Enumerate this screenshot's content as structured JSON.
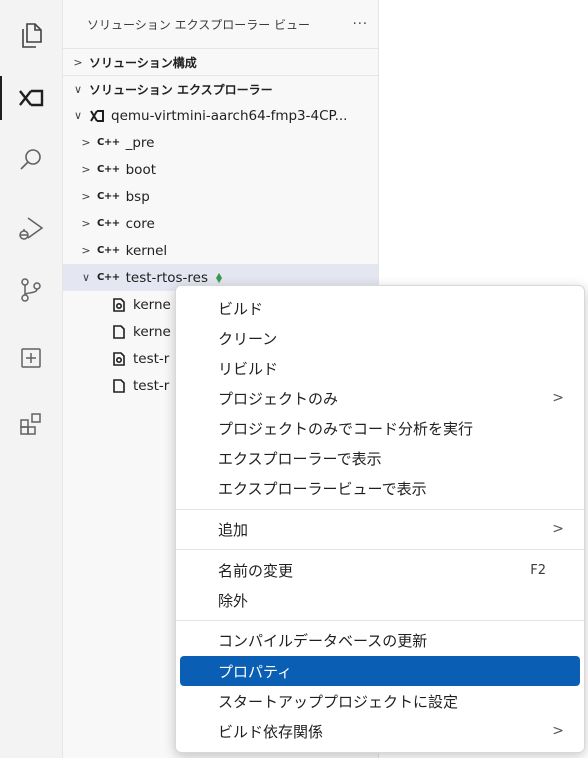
{
  "sidebar": {
    "title": "ソリューション エクスプローラー ビュー",
    "more": "···",
    "sections": {
      "config": "ソリューション構成",
      "explorer": "ソリューション エクスプローラー"
    },
    "project": "qemu-virtmini-aarch64-fmp3-4CP...",
    "folders": [
      "_pre",
      "boot",
      "bsp",
      "core",
      "kernel"
    ],
    "expanded_folder": "test-rtos-res",
    "files": [
      "kerne",
      "kerne",
      "test-r",
      "test-r"
    ]
  },
  "menu": {
    "items": [
      {
        "label": "ビルド"
      },
      {
        "label": "クリーン"
      },
      {
        "label": "リビルド"
      },
      {
        "label": "プロジェクトのみ",
        "submenu": true
      },
      {
        "label": "プロジェクトのみでコード分析を実行"
      },
      {
        "label": "エクスプローラーで表示"
      },
      {
        "label": "エクスプローラービューで表示"
      },
      {
        "label": "追加",
        "submenu": true
      },
      {
        "label": "名前の変更",
        "shortcut": "F2"
      },
      {
        "label": "除外"
      },
      {
        "label": "コンパイルデータベースの更新"
      },
      {
        "label": "プロパティ",
        "highlighted": true
      },
      {
        "label": "スタートアッププロジェクトに設定"
      },
      {
        "label": "ビルド依存関係",
        "submenu": true
      }
    ],
    "submenu_glyph": ">"
  },
  "glyphs": {
    "cpp": "C++",
    "chev_right": ">",
    "chev_down": "∨"
  },
  "colors": {
    "highlight": "#0a5fb4",
    "activity_bg": "#f3f3f3",
    "sidebar_bg": "#f8f8f8"
  },
  "icons": [
    "explorer-icon",
    "solution-explorer-icon",
    "search-icon",
    "run-debug-icon",
    "source-control-icon",
    "add-panel-icon",
    "extensions-icon"
  ]
}
